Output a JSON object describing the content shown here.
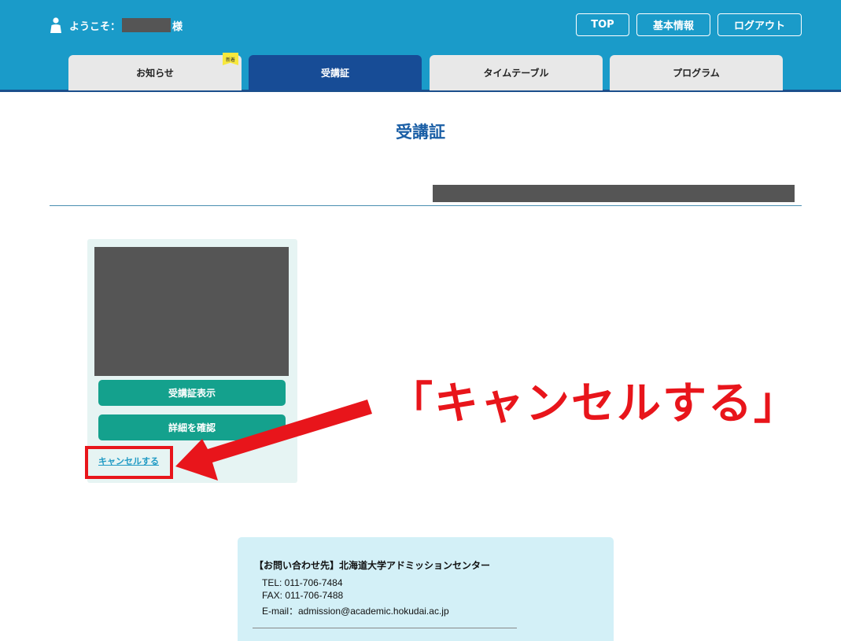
{
  "header": {
    "welcome_prefix": "ようこそ：",
    "welcome_suffix": "様",
    "buttons": {
      "top": "TOP",
      "basic_info": "基本情報",
      "logout": "ログアウト"
    },
    "tabs": [
      {
        "label": "お知らせ",
        "active": false
      },
      {
        "label": "受講証",
        "active": true
      },
      {
        "label": "タイムテーブル",
        "active": false
      },
      {
        "label": "プログラム",
        "active": false
      }
    ],
    "new_badge": "新着"
  },
  "main": {
    "title": "受講証",
    "card": {
      "show_button": "受講証表示",
      "details_button": "詳細を確認",
      "cancel_link": "キャンセルする"
    }
  },
  "annotation": {
    "callout": "「キャンセルする」",
    "color": "#e8151b"
  },
  "contact": {
    "title": "【お問い合わせ先】北海道大学アドミッションセンター",
    "tel": "TEL: 011-706-7484",
    "fax": "FAX: 011-706-7488",
    "email": "E-mail：admission@academic.hokudai.ac.jp"
  },
  "colors": {
    "header_bg": "#1a9bc9",
    "active_tab": "#174c96",
    "teal_button": "#14a18d",
    "title_blue": "#1b5fa6"
  }
}
